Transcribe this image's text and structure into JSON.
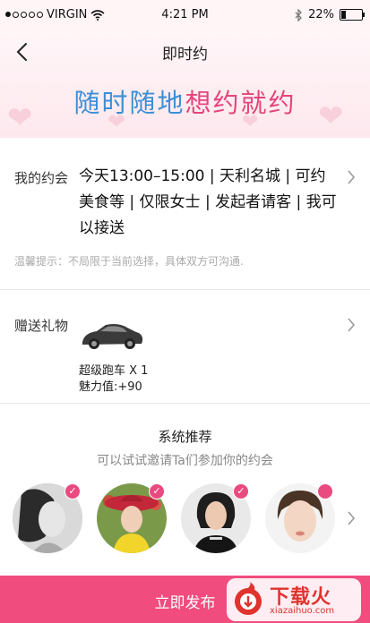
{
  "status_bar": {
    "carrier": "VIRGIN",
    "time": "4:21 PM",
    "battery": "22%",
    "battery_level": 0.22,
    "icons": [
      "signal-dots-icon",
      "wifi-icon",
      "bluetooth-icon",
      "battery-icon"
    ]
  },
  "header": {
    "title": "即时约",
    "banner_part1": "随时随地",
    "banner_part2": "想约就约"
  },
  "date_section": {
    "label": "我的约会",
    "details": "今天13:00–15:00 | 天利名城 | 可约美食等 | 仅限女士 | 发起者请客 | 我可以接送",
    "tip": "温馨提示：不局限于当前选择，具体双方可沟通."
  },
  "gift_section": {
    "label": "赠送礼物",
    "gift_name": "超级跑车 X 1",
    "charm": "魅力值:+90"
  },
  "recommend": {
    "title": "系统推荐",
    "subtitle": "可以试试邀请Ta们参加你的约会",
    "avatars": [
      "avatar-1",
      "avatar-2",
      "avatar-3",
      "avatar-4"
    ]
  },
  "bottom": {
    "label": "立即发布"
  },
  "watermark": {
    "text": "下载火",
    "domain": "xiazaihuo.com"
  },
  "colors": {
    "accent_pink": "#f04c7d",
    "banner_blue": "#3d8fd6",
    "banner_pink": "#e5447a"
  }
}
